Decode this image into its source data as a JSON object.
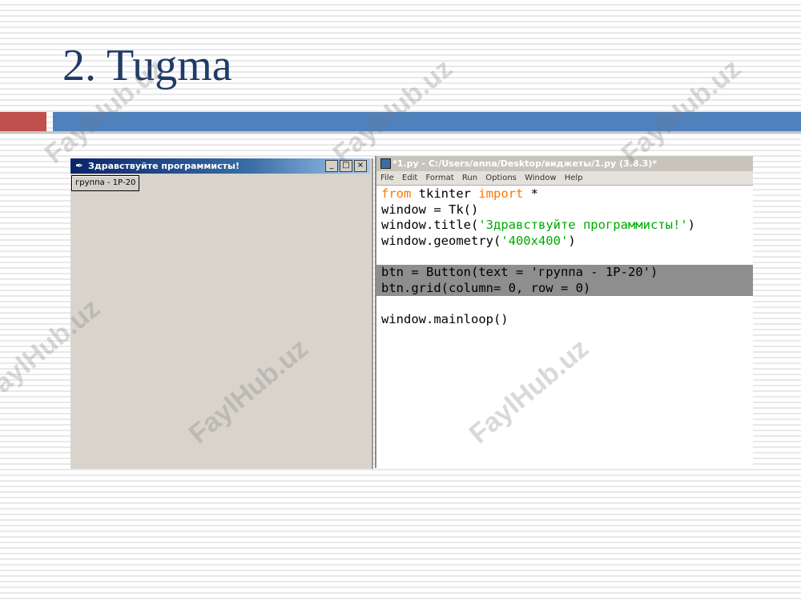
{
  "slide": {
    "title": "2. Tugma"
  },
  "tk_window": {
    "title": "Здравствуйте программисты!",
    "controls": [
      "_",
      "□",
      "×"
    ],
    "button_label": "группа - 1Р-20"
  },
  "idle_window": {
    "title": "*1.py - C:/Users/anna/Desktop/виджеты/1.py (3.8.3)*",
    "menu": [
      "File",
      "Edit",
      "Format",
      "Run",
      "Options",
      "Window",
      "Help"
    ],
    "code": [
      {
        "kw1": "from",
        "t1": " tkinter ",
        "kw2": "import",
        "t2": " *"
      },
      {
        "t1": "window = Tk()"
      },
      {
        "t1": "window.title(",
        "str": "'Здравствуйте программисты!'",
        "t2": ")"
      },
      {
        "t1": "window.geometry(",
        "str": "'400x400'",
        "t2": ")"
      },
      {
        "t1": ""
      },
      {
        "t1": "btn = Button(text = 'группа - 1Р-20')"
      },
      {
        "t1": "btn.grid(column= 0, row = 0)"
      },
      {
        "t1": ""
      },
      {
        "t1": "window.mainloop()"
      }
    ]
  },
  "watermark": "FaylHub.uz"
}
